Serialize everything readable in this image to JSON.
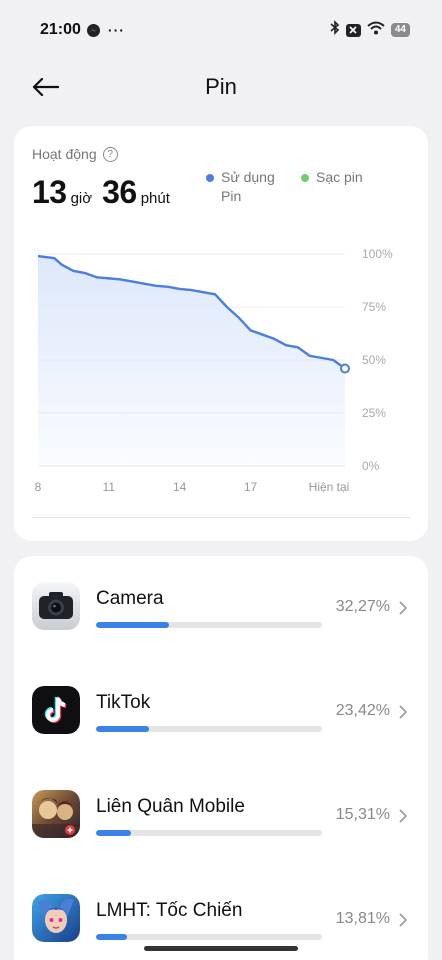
{
  "status_bar": {
    "time": "21:00",
    "more": "···",
    "battery": "44",
    "icons": [
      "messenger-icon",
      "bluetooth-icon",
      "x-badge-icon",
      "wifi-icon",
      "battery-icon"
    ]
  },
  "header": {
    "title": "Pin",
    "back_icon": "arrow-left-icon"
  },
  "activity": {
    "label": "Hoạt động",
    "help": "?",
    "hours": "13",
    "hours_unit": "giờ",
    "minutes": "36",
    "minutes_unit": "phút",
    "legend": [
      {
        "label": "Sử dụng Pin",
        "color": "#4a7fe0"
      },
      {
        "label": "Sạc pin",
        "color": "#6fcf6f"
      }
    ]
  },
  "chart_data": {
    "type": "area",
    "x": [
      8.0,
      8.7,
      9.0,
      9.5,
      10.0,
      10.5,
      11.0,
      11.5,
      12.0,
      12.5,
      13.0,
      13.5,
      14.0,
      14.5,
      15.0,
      15.5,
      16.0,
      16.5,
      17.0,
      17.5,
      18.0,
      18.5,
      19.0,
      19.5,
      20.0,
      20.5,
      21.0
    ],
    "values": [
      99,
      98,
      95,
      92,
      91,
      89,
      88.5,
      88,
      87,
      86,
      85,
      84.5,
      83.5,
      83,
      82,
      81,
      75,
      70,
      64,
      62,
      60,
      57,
      56,
      52,
      51,
      50,
      46
    ],
    "xticks": [
      "8",
      "11",
      "14",
      "17",
      "Hiện tại"
    ],
    "xtick_values": [
      8,
      11,
      14,
      17,
      21
    ],
    "yticks": [
      "100%",
      "75%",
      "50%",
      "25%",
      "0%"
    ],
    "ytick_values": [
      100,
      75,
      50,
      25,
      0
    ],
    "xlim": [
      8,
      21
    ],
    "ylim": [
      0,
      100
    ],
    "line_color": "#4a7fe0",
    "fill_color": "#dde8fb",
    "grid": true
  },
  "apps": [
    {
      "name": "Camera",
      "percent": "32,27%",
      "fraction": 0.3227,
      "icon": "camera-icon"
    },
    {
      "name": "TikTok",
      "percent": "23,42%",
      "fraction": 0.2342,
      "icon": "tiktok-icon"
    },
    {
      "name": "Liên Quân Mobile",
      "percent": "15,31%",
      "fraction": 0.1531,
      "icon": "lien-quan-icon"
    },
    {
      "name": "LMHT: Tốc Chiến",
      "percent": "13,81%",
      "fraction": 0.1381,
      "icon": "lmht-icon"
    }
  ]
}
